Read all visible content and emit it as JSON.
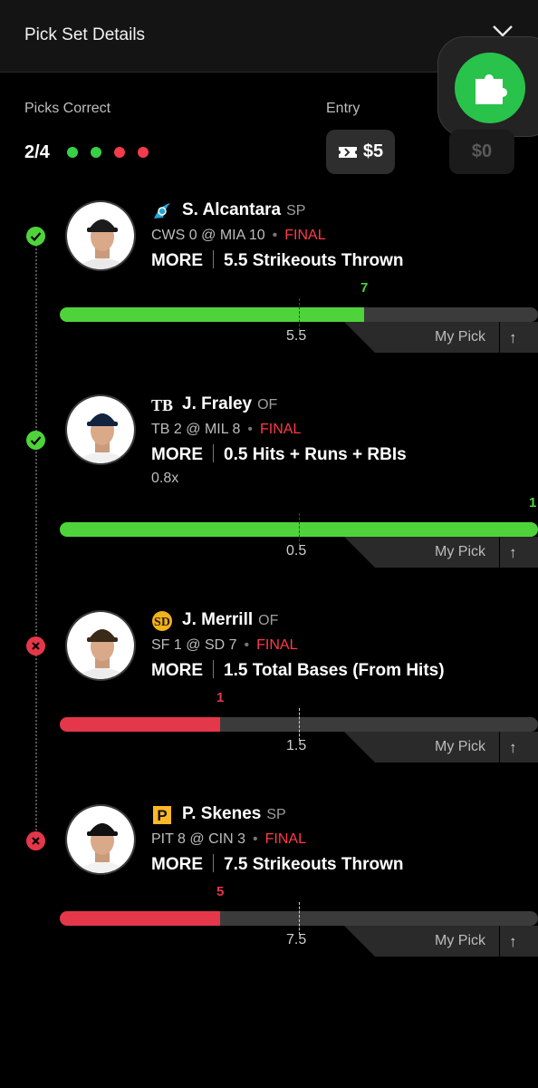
{
  "header": {
    "title": "Pick Set Details"
  },
  "summary": {
    "picks_correct_label": "Picks Correct",
    "score": "2/4",
    "dots": [
      "#38d146",
      "#38d146",
      "#f23b4c",
      "#f23b4c"
    ],
    "entry_label": "Entry",
    "entry_amount": "$5",
    "payout_amount": "$0"
  },
  "colors": {
    "win": "#4fd33b",
    "loss": "#e5374a",
    "final": "#ff3b4a"
  },
  "picks": [
    {
      "player": "S. Alcantara",
      "position": "SP",
      "team_logo": "marlins-logo",
      "matchup_away": "CWS 0",
      "matchup_at": "@",
      "matchup_home": "MIA 10",
      "status": "FINAL",
      "direction": "MORE",
      "line": "5.5",
      "stat": "Strikeouts Thrown",
      "multiplier": "",
      "result": "7",
      "line_label": "5.5",
      "my_pick": "My Pick",
      "outcome": "win",
      "line_fraction": 0.5,
      "result_fraction": 0.637
    },
    {
      "player": "J. Fraley",
      "position": "OF",
      "team_logo": "rays-logo",
      "matchup_away": "TB 2",
      "matchup_at": "@",
      "matchup_home": "MIL 8",
      "status": "FINAL",
      "direction": "MORE",
      "line": "0.5",
      "stat": "Hits + Runs + RBIs",
      "multiplier": "0.8x",
      "result": "1",
      "line_label": "0.5",
      "my_pick": "My Pick",
      "outcome": "win",
      "line_fraction": 0.5,
      "result_fraction": 1.0
    },
    {
      "player": "J. Merrill",
      "position": "OF",
      "team_logo": "padres-logo",
      "matchup_away": "SF 1",
      "matchup_at": "@",
      "matchup_home": "SD 7",
      "status": "FINAL",
      "direction": "MORE",
      "line": "1.5",
      "stat": "Total Bases (From Hits)",
      "multiplier": "",
      "result": "1",
      "line_label": "1.5",
      "my_pick": "My Pick",
      "outcome": "loss",
      "line_fraction": 0.5,
      "result_fraction": 0.335
    },
    {
      "player": "P. Skenes",
      "position": "SP",
      "team_logo": "pirates-logo",
      "matchup_away": "PIT 8",
      "matchup_at": "@",
      "matchup_home": "CIN 3",
      "status": "FINAL",
      "direction": "MORE",
      "line": "7.5",
      "stat": "Strikeouts Thrown",
      "multiplier": "",
      "result": "5",
      "line_label": "7.5",
      "my_pick": "My Pick",
      "outcome": "loss",
      "line_fraction": 0.5,
      "result_fraction": 0.335
    }
  ]
}
